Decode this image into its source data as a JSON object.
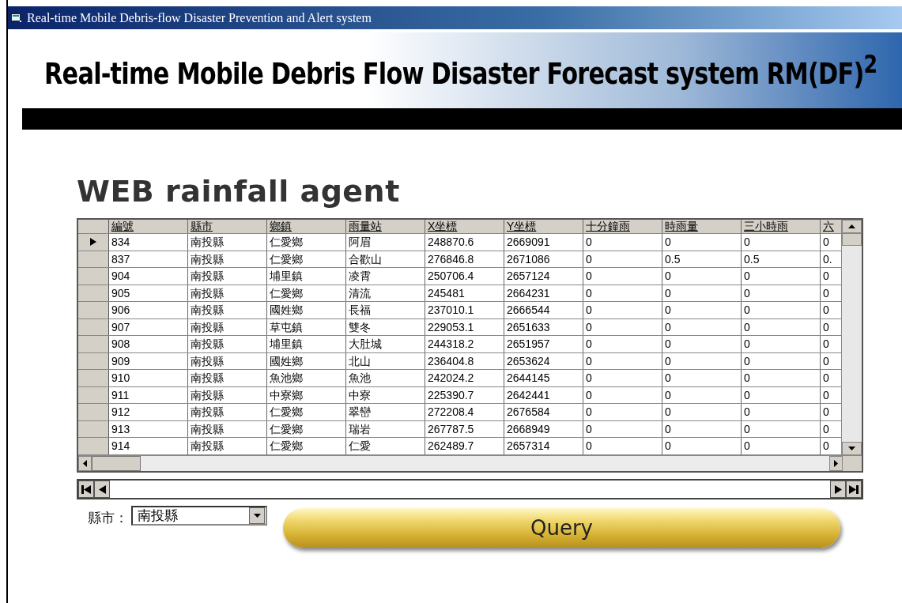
{
  "window": {
    "title": "Real-time Mobile Debris-flow Disaster Prevention and Alert system"
  },
  "banner": {
    "title": "Real-time Mobile Debris Flow Disaster Forecast system RM(DF)$^{2}$"
  },
  "heading": "WEB rainfall agent",
  "grid": {
    "columns": [
      "編號",
      "縣市",
      "鄉鎮",
      "雨量站",
      "X坐標",
      "Y坐標",
      "十分鐘雨",
      "時雨量",
      "三小時雨",
      "六"
    ],
    "rows": [
      {
        "selected": true,
        "cells": [
          "834",
          "南投縣",
          "仁愛鄉",
          "阿眉",
          "248870.6",
          "2669091",
          "0",
          "0",
          "0",
          "0"
        ]
      },
      {
        "selected": false,
        "cells": [
          "837",
          "南投縣",
          "仁愛鄉",
          "合歡山",
          "276846.8",
          "2671086",
          "0",
          "0.5",
          "0.5",
          "0."
        ]
      },
      {
        "selected": false,
        "cells": [
          "904",
          "南投縣",
          "埔里鎮",
          "凌霄",
          "250706.4",
          "2657124",
          "0",
          "0",
          "0",
          "0"
        ]
      },
      {
        "selected": false,
        "cells": [
          "905",
          "南投縣",
          "仁愛鄉",
          "清流",
          "245481",
          "2664231",
          "0",
          "0",
          "0",
          "0"
        ]
      },
      {
        "selected": false,
        "cells": [
          "906",
          "南投縣",
          "國姓鄉",
          "長福",
          "237010.1",
          "2666544",
          "0",
          "0",
          "0",
          "0"
        ]
      },
      {
        "selected": false,
        "cells": [
          "907",
          "南投縣",
          "草屯鎮",
          "雙冬",
          "229053.1",
          "2651633",
          "0",
          "0",
          "0",
          "0"
        ]
      },
      {
        "selected": false,
        "cells": [
          "908",
          "南投縣",
          "埔里鎮",
          "大肚城",
          "244318.2",
          "2651957",
          "0",
          "0",
          "0",
          "0"
        ]
      },
      {
        "selected": false,
        "cells": [
          "909",
          "南投縣",
          "國姓鄉",
          "北山",
          "236404.8",
          "2653624",
          "0",
          "0",
          "0",
          "0"
        ]
      },
      {
        "selected": false,
        "cells": [
          "910",
          "南投縣",
          "魚池鄉",
          "魚池",
          "242024.2",
          "2644145",
          "0",
          "0",
          "0",
          "0"
        ]
      },
      {
        "selected": false,
        "cells": [
          "911",
          "南投縣",
          "中寮鄉",
          "中寮",
          "225390.7",
          "2642441",
          "0",
          "0",
          "0",
          "0"
        ]
      },
      {
        "selected": false,
        "cells": [
          "912",
          "南投縣",
          "仁愛鄉",
          "翠巒",
          "272208.4",
          "2676584",
          "0",
          "0",
          "0",
          "0"
        ]
      },
      {
        "selected": false,
        "cells": [
          "913",
          "南投縣",
          "仁愛鄉",
          "瑞岩",
          "267787.5",
          "2668949",
          "0",
          "0",
          "0",
          "0"
        ]
      },
      {
        "selected": false,
        "cells": [
          "914",
          "南投縣",
          "仁愛鄉",
          "仁愛",
          "262489.7",
          "2657314",
          "0",
          "0",
          "0",
          "0"
        ]
      }
    ]
  },
  "county": {
    "label": "縣市：",
    "value": "南投縣"
  },
  "query_button": "Query"
}
